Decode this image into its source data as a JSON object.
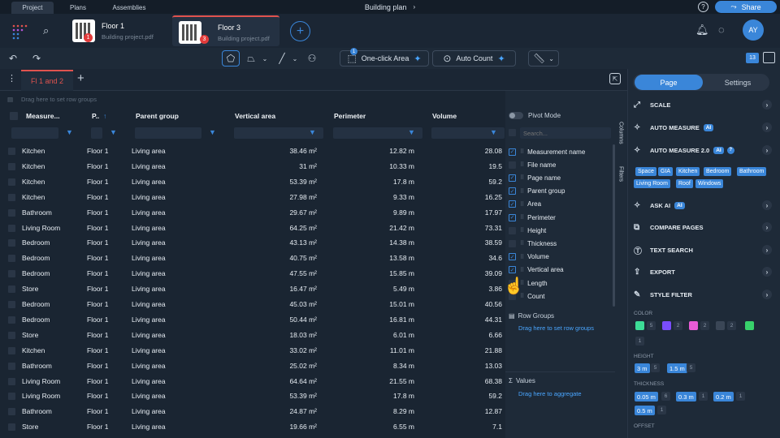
{
  "topbar": {
    "tabs": [
      "Project",
      "Plans",
      "Assemblies"
    ],
    "doc_title": "Building plan",
    "share_label": "Share",
    "help_icon": "?"
  },
  "files": [
    {
      "name": "Floor 1",
      "sub": "Building project.pdf",
      "badge": "1"
    },
    {
      "name": "Floor 3",
      "sub": "Building project.pdf",
      "badge": "3"
    }
  ],
  "avatar": "AY",
  "toolbar": {
    "one_click": "One-click Area",
    "auto_count": "Auto Count",
    "count_badge": "13",
    "tool_badge": "1"
  },
  "tabs": {
    "active": "Fl 1 and 2"
  },
  "grid": {
    "drag_hint": "Drag here to set row groups",
    "columns": [
      "Measure...",
      "P..",
      "Parent group",
      "Vertical area",
      "Perimeter",
      "Volume"
    ],
    "rows": [
      [
        "Kitchen",
        "Floor 1",
        "Living area",
        "38.46 m²",
        "12.82 m",
        "28.08"
      ],
      [
        "Kitchen",
        "Floor 1",
        "Living area",
        "31 m²",
        "10.33 m",
        "19.5"
      ],
      [
        "Kitchen",
        "Floor 1",
        "Living area",
        "53.39 m²",
        "17.8 m",
        "59.2"
      ],
      [
        "Kitchen",
        "Floor 1",
        "Living area",
        "27.98 m²",
        "9.33 m",
        "16.25"
      ],
      [
        "Bathroom",
        "Floor 1",
        "Living area",
        "29.67 m²",
        "9.89 m",
        "17.97"
      ],
      [
        "Living Room",
        "Floor 1",
        "Living area",
        "64.25 m²",
        "21.42 m",
        "73.31"
      ],
      [
        "Bedroom",
        "Floor 1",
        "Living area",
        "43.13 m²",
        "14.38 m",
        "38.59"
      ],
      [
        "Bedroom",
        "Floor 1",
        "Living area",
        "40.75 m²",
        "13.58 m",
        "34.6"
      ],
      [
        "Bedroom",
        "Floor 1",
        "Living area",
        "47.55 m²",
        "15.85 m",
        "39.09"
      ],
      [
        "Store",
        "Floor 1",
        "Living area",
        "16.47 m²",
        "5.49 m",
        "3.86"
      ],
      [
        "Bedroom",
        "Floor 1",
        "Living area",
        "45.03 m²",
        "15.01 m",
        "40.56"
      ],
      [
        "Bedroom",
        "Floor 1",
        "Living area",
        "50.44 m²",
        "16.81 m",
        "44.31"
      ],
      [
        "Store",
        "Floor 1",
        "Living area",
        "18.03 m²",
        "6.01 m",
        "6.66"
      ],
      [
        "Kitchen",
        "Floor 1",
        "Living area",
        "33.02 m²",
        "11.01 m",
        "21.88"
      ],
      [
        "Bathroom",
        "Floor 1",
        "Living area",
        "25.02 m²",
        "8.34 m",
        "13.03"
      ],
      [
        "Living Room",
        "Floor 1",
        "Living area",
        "64.64 m²",
        "21.55 m",
        "68.38"
      ],
      [
        "Living Room",
        "Floor 1",
        "Living area",
        "53.39 m²",
        "17.8 m",
        "59.2"
      ],
      [
        "Bathroom",
        "Floor 1",
        "Living area",
        "24.87 m²",
        "8.29 m",
        "12.87"
      ],
      [
        "Store",
        "Floor 1",
        "Living area",
        "19.66 m²",
        "6.55 m",
        "7.1"
      ]
    ]
  },
  "colpanel": {
    "pivot": "Pivot Mode",
    "search_placeholder": "Search...",
    "items": [
      {
        "label": "Measurement name",
        "checked": true
      },
      {
        "label": "File name",
        "checked": false
      },
      {
        "label": "Page name",
        "checked": true
      },
      {
        "label": "Parent group",
        "checked": true
      },
      {
        "label": "Area",
        "checked": true
      },
      {
        "label": "Perimeter",
        "checked": true
      },
      {
        "label": "Height",
        "checked": false
      },
      {
        "label": "Thickness",
        "checked": false
      },
      {
        "label": "Volume",
        "checked": true
      },
      {
        "label": "Vertical area",
        "checked": true
      },
      {
        "label": "Length",
        "checked": false
      },
      {
        "label": "Count",
        "checked": false
      }
    ],
    "row_groups": "Row Groups",
    "row_groups_hint": "Drag here to set row groups",
    "values": "Values",
    "values_hint": "Drag here to aggregate",
    "side_columns": "Columns",
    "side_filters": "Filters"
  },
  "rpanel": {
    "page": "Page",
    "settings": "Settings",
    "items": [
      "SCALE",
      "AUTO MEASURE",
      "AUTO MEASURE 2.0",
      "ASK AI",
      "COMPARE PAGES",
      "TEXT SEARCH",
      "EXPORT",
      "STYLE FILTER"
    ],
    "ai_tag": "AI",
    "chips": [
      "Space",
      "GIA",
      "Kitchen",
      "Bedroom",
      "Bathroom",
      "Living Room",
      "Roof",
      "Windows"
    ],
    "color_label": "COLOR",
    "height_label": "HEIGHT",
    "thickness_label": "THICKNESS",
    "offset_label": "OFFSET",
    "colors": [
      {
        "hex": "#3ddc97",
        "count": "5"
      },
      {
        "hex": "#7a4dff",
        "count": "2"
      },
      {
        "hex": "#e85bd6",
        "count": "2"
      },
      {
        "hex": "#3a4656",
        "count": "2"
      },
      {
        "hex": "#38d16b",
        "count": "1"
      }
    ],
    "heights": [
      {
        "v": "3 m",
        "c": "5"
      },
      {
        "v": "1.5 m",
        "c": "5"
      }
    ],
    "thickness": [
      {
        "v": "0.05 m",
        "c": "6"
      },
      {
        "v": "0.3 m",
        "c": "1"
      },
      {
        "v": "0.2 m",
        "c": "1"
      },
      {
        "v": "0.5 m",
        "c": "1"
      }
    ]
  }
}
